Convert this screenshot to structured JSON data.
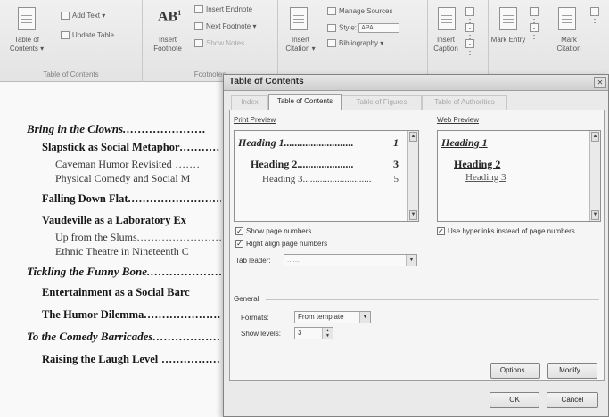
{
  "ribbon": {
    "groups": [
      {
        "label": "Table of Contents",
        "items": {
          "toc": "Table of Contents ▾",
          "add_text": "Add Text ▾",
          "update_table": "Update Table"
        }
      },
      {
        "label": "Footnotes",
        "items": {
          "insert_footnote": "Insert Footnote",
          "insert_endnote": "Insert Endnote",
          "next_footnote": "Next Footnote ▾",
          "show_notes": "Show Notes"
        }
      },
      {
        "label": "",
        "items": {
          "insert_citation": "Insert Citation ▾",
          "manage_sources": "Manage Sources",
          "style_label": "Style:",
          "style_value": "APA",
          "bibliography": "Bibliography ▾"
        }
      },
      {
        "label": "",
        "items": {
          "insert_caption": "Insert Caption"
        }
      },
      {
        "label": "",
        "items": {
          "mark_entry": "Mark Entry"
        }
      },
      {
        "label": "",
        "items": {
          "mark_citation": "Mark Citation"
        }
      }
    ]
  },
  "document": {
    "toc_entries": [
      {
        "text": "Bring in the Clowns",
        "level": 1
      },
      {
        "text": "Slapstick as Social Metaphor",
        "level": 2
      },
      {
        "text": "Caveman Humor Revisited",
        "level": 3
      },
      {
        "text": "Physical Comedy and Social M",
        "level": 3
      },
      {
        "text": "Falling Down Flat",
        "level": 2
      },
      {
        "text": "Vaudeville as a Laboratory Ex",
        "level": 2
      },
      {
        "text": "Up from the Slums",
        "level": 3
      },
      {
        "text": "Ethnic Theatre in Nineteenth C",
        "level": 3
      },
      {
        "text": "Tickling the Funny Bone",
        "level": 1
      },
      {
        "text": "Entertainment as a Social Barc",
        "level": 2
      },
      {
        "text": "The Humor Dilemma",
        "level": 2
      },
      {
        "text": "To the Comedy Barricades",
        "level": 1
      },
      {
        "text": "Raising the Laugh Level",
        "level": 2
      }
    ]
  },
  "dialog": {
    "title": "Table of Contents",
    "close_symbol": "✕",
    "tabs": [
      "Index",
      "Table of Contents",
      "Table of Figures",
      "Table of Authorities"
    ],
    "active_tab": "Table of Contents",
    "print_preview": {
      "label": "Print Preview",
      "lines": [
        {
          "text": "Heading 1",
          "page": "1"
        },
        {
          "text": "Heading 2",
          "page": "3"
        },
        {
          "text": "Heading 3",
          "page": "5"
        }
      ]
    },
    "web_preview": {
      "label": "Web Preview",
      "lines": [
        "Heading 1",
        "Heading 2",
        "Heading 3"
      ]
    },
    "options": {
      "show_page_numbers": {
        "label": "Show page numbers",
        "checked": true
      },
      "right_align": {
        "label": "Right align page numbers",
        "checked": true
      },
      "use_hyperlinks": {
        "label": "Use hyperlinks instead of page numbers",
        "checked": true
      },
      "tab_leader": {
        "label": "Tab leader:",
        "value": "......."
      }
    },
    "general": {
      "label": "General",
      "formats_label": "Formats:",
      "formats_value": "From template",
      "show_levels_label": "Show levels:",
      "show_levels_value": "3"
    },
    "buttons": {
      "options": "Options...",
      "modify": "Modify...",
      "ok": "OK",
      "cancel": "Cancel"
    }
  }
}
